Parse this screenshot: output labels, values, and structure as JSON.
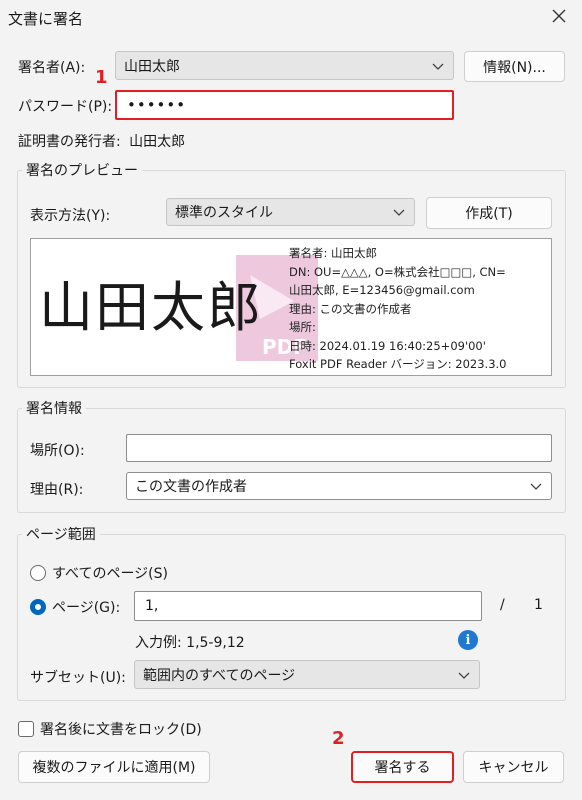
{
  "window": {
    "title": "文書に署名"
  },
  "signer": {
    "label": "署名者(A):",
    "value": "山田太郎",
    "info_button": "情報(N)..."
  },
  "password": {
    "label": "パスワード(P):",
    "value": "••••••"
  },
  "issuer": {
    "label": "証明書の発行者:",
    "value": "山田太郎"
  },
  "annotations": {
    "step1": "1",
    "step2": "2"
  },
  "preview_group": {
    "legend": "署名のプレビュー",
    "display_label": "表示方法(Y):",
    "display_value": "標準のスタイル",
    "create_button": "作成(T)",
    "signature_name": "山田太郎",
    "watermark": "PDF",
    "details": [
      "署名者: 山田太郎",
      "DN: OU=△△△, O=株式会社□□□, CN=",
      "山田太郎, E=123456@gmail.com",
      "理由: この文書の作成者",
      "場所:",
      "日時: 2024.01.19 16:40:25+09'00'",
      "Foxit PDF Reader バージョン: 2023.3.0"
    ]
  },
  "sig_info_group": {
    "legend": "署名情報",
    "location_label": "場所(O):",
    "location_value": "",
    "reason_label": "理由(R):",
    "reason_value": "この文書の作成者"
  },
  "page_range_group": {
    "legend": "ページ範囲",
    "all_pages_label": "すべてのページ(S)",
    "pages_label": "ページ(G):",
    "pages_value": "1,",
    "slash": "/",
    "total_pages": "1",
    "example": "入力例: 1,5-9,12",
    "info_icon": "i",
    "subset_label": "サブセット(U):",
    "subset_value": "範囲内のすべてのページ",
    "selected": "pages"
  },
  "lock": {
    "label": "署名後に文書をロック(D)",
    "checked": false
  },
  "buttons": {
    "apply_multiple": "複数のファイルに適用(M)",
    "sign": "署名する",
    "cancel": "キャンセル"
  }
}
